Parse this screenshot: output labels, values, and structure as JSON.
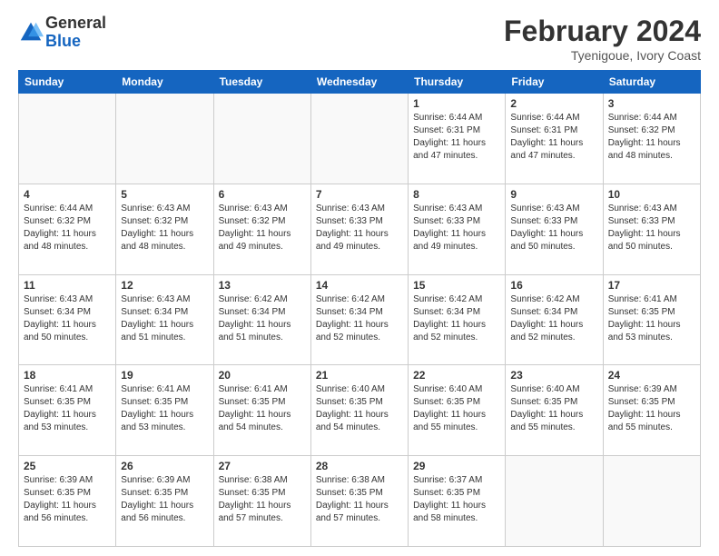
{
  "logo": {
    "general": "General",
    "blue": "Blue"
  },
  "title": {
    "month": "February 2024",
    "location": "Tyenigoue, Ivory Coast"
  },
  "weekdays": [
    "Sunday",
    "Monday",
    "Tuesday",
    "Wednesday",
    "Thursday",
    "Friday",
    "Saturday"
  ],
  "weeks": [
    [
      {
        "day": "",
        "info": ""
      },
      {
        "day": "",
        "info": ""
      },
      {
        "day": "",
        "info": ""
      },
      {
        "day": "",
        "info": ""
      },
      {
        "day": "1",
        "info": "Sunrise: 6:44 AM\nSunset: 6:31 PM\nDaylight: 11 hours\nand 47 minutes."
      },
      {
        "day": "2",
        "info": "Sunrise: 6:44 AM\nSunset: 6:31 PM\nDaylight: 11 hours\nand 47 minutes."
      },
      {
        "day": "3",
        "info": "Sunrise: 6:44 AM\nSunset: 6:32 PM\nDaylight: 11 hours\nand 48 minutes."
      }
    ],
    [
      {
        "day": "4",
        "info": "Sunrise: 6:44 AM\nSunset: 6:32 PM\nDaylight: 11 hours\nand 48 minutes."
      },
      {
        "day": "5",
        "info": "Sunrise: 6:43 AM\nSunset: 6:32 PM\nDaylight: 11 hours\nand 48 minutes."
      },
      {
        "day": "6",
        "info": "Sunrise: 6:43 AM\nSunset: 6:32 PM\nDaylight: 11 hours\nand 49 minutes."
      },
      {
        "day": "7",
        "info": "Sunrise: 6:43 AM\nSunset: 6:33 PM\nDaylight: 11 hours\nand 49 minutes."
      },
      {
        "day": "8",
        "info": "Sunrise: 6:43 AM\nSunset: 6:33 PM\nDaylight: 11 hours\nand 49 minutes."
      },
      {
        "day": "9",
        "info": "Sunrise: 6:43 AM\nSunset: 6:33 PM\nDaylight: 11 hours\nand 50 minutes."
      },
      {
        "day": "10",
        "info": "Sunrise: 6:43 AM\nSunset: 6:33 PM\nDaylight: 11 hours\nand 50 minutes."
      }
    ],
    [
      {
        "day": "11",
        "info": "Sunrise: 6:43 AM\nSunset: 6:34 PM\nDaylight: 11 hours\nand 50 minutes."
      },
      {
        "day": "12",
        "info": "Sunrise: 6:43 AM\nSunset: 6:34 PM\nDaylight: 11 hours\nand 51 minutes."
      },
      {
        "day": "13",
        "info": "Sunrise: 6:42 AM\nSunset: 6:34 PM\nDaylight: 11 hours\nand 51 minutes."
      },
      {
        "day": "14",
        "info": "Sunrise: 6:42 AM\nSunset: 6:34 PM\nDaylight: 11 hours\nand 52 minutes."
      },
      {
        "day": "15",
        "info": "Sunrise: 6:42 AM\nSunset: 6:34 PM\nDaylight: 11 hours\nand 52 minutes."
      },
      {
        "day": "16",
        "info": "Sunrise: 6:42 AM\nSunset: 6:34 PM\nDaylight: 11 hours\nand 52 minutes."
      },
      {
        "day": "17",
        "info": "Sunrise: 6:41 AM\nSunset: 6:35 PM\nDaylight: 11 hours\nand 53 minutes."
      }
    ],
    [
      {
        "day": "18",
        "info": "Sunrise: 6:41 AM\nSunset: 6:35 PM\nDaylight: 11 hours\nand 53 minutes."
      },
      {
        "day": "19",
        "info": "Sunrise: 6:41 AM\nSunset: 6:35 PM\nDaylight: 11 hours\nand 53 minutes."
      },
      {
        "day": "20",
        "info": "Sunrise: 6:41 AM\nSunset: 6:35 PM\nDaylight: 11 hours\nand 54 minutes."
      },
      {
        "day": "21",
        "info": "Sunrise: 6:40 AM\nSunset: 6:35 PM\nDaylight: 11 hours\nand 54 minutes."
      },
      {
        "day": "22",
        "info": "Sunrise: 6:40 AM\nSunset: 6:35 PM\nDaylight: 11 hours\nand 55 minutes."
      },
      {
        "day": "23",
        "info": "Sunrise: 6:40 AM\nSunset: 6:35 PM\nDaylight: 11 hours\nand 55 minutes."
      },
      {
        "day": "24",
        "info": "Sunrise: 6:39 AM\nSunset: 6:35 PM\nDaylight: 11 hours\nand 55 minutes."
      }
    ],
    [
      {
        "day": "25",
        "info": "Sunrise: 6:39 AM\nSunset: 6:35 PM\nDaylight: 11 hours\nand 56 minutes."
      },
      {
        "day": "26",
        "info": "Sunrise: 6:39 AM\nSunset: 6:35 PM\nDaylight: 11 hours\nand 56 minutes."
      },
      {
        "day": "27",
        "info": "Sunrise: 6:38 AM\nSunset: 6:35 PM\nDaylight: 11 hours\nand 57 minutes."
      },
      {
        "day": "28",
        "info": "Sunrise: 6:38 AM\nSunset: 6:35 PM\nDaylight: 11 hours\nand 57 minutes."
      },
      {
        "day": "29",
        "info": "Sunrise: 6:37 AM\nSunset: 6:35 PM\nDaylight: 11 hours\nand 58 minutes."
      },
      {
        "day": "",
        "info": ""
      },
      {
        "day": "",
        "info": ""
      }
    ]
  ]
}
